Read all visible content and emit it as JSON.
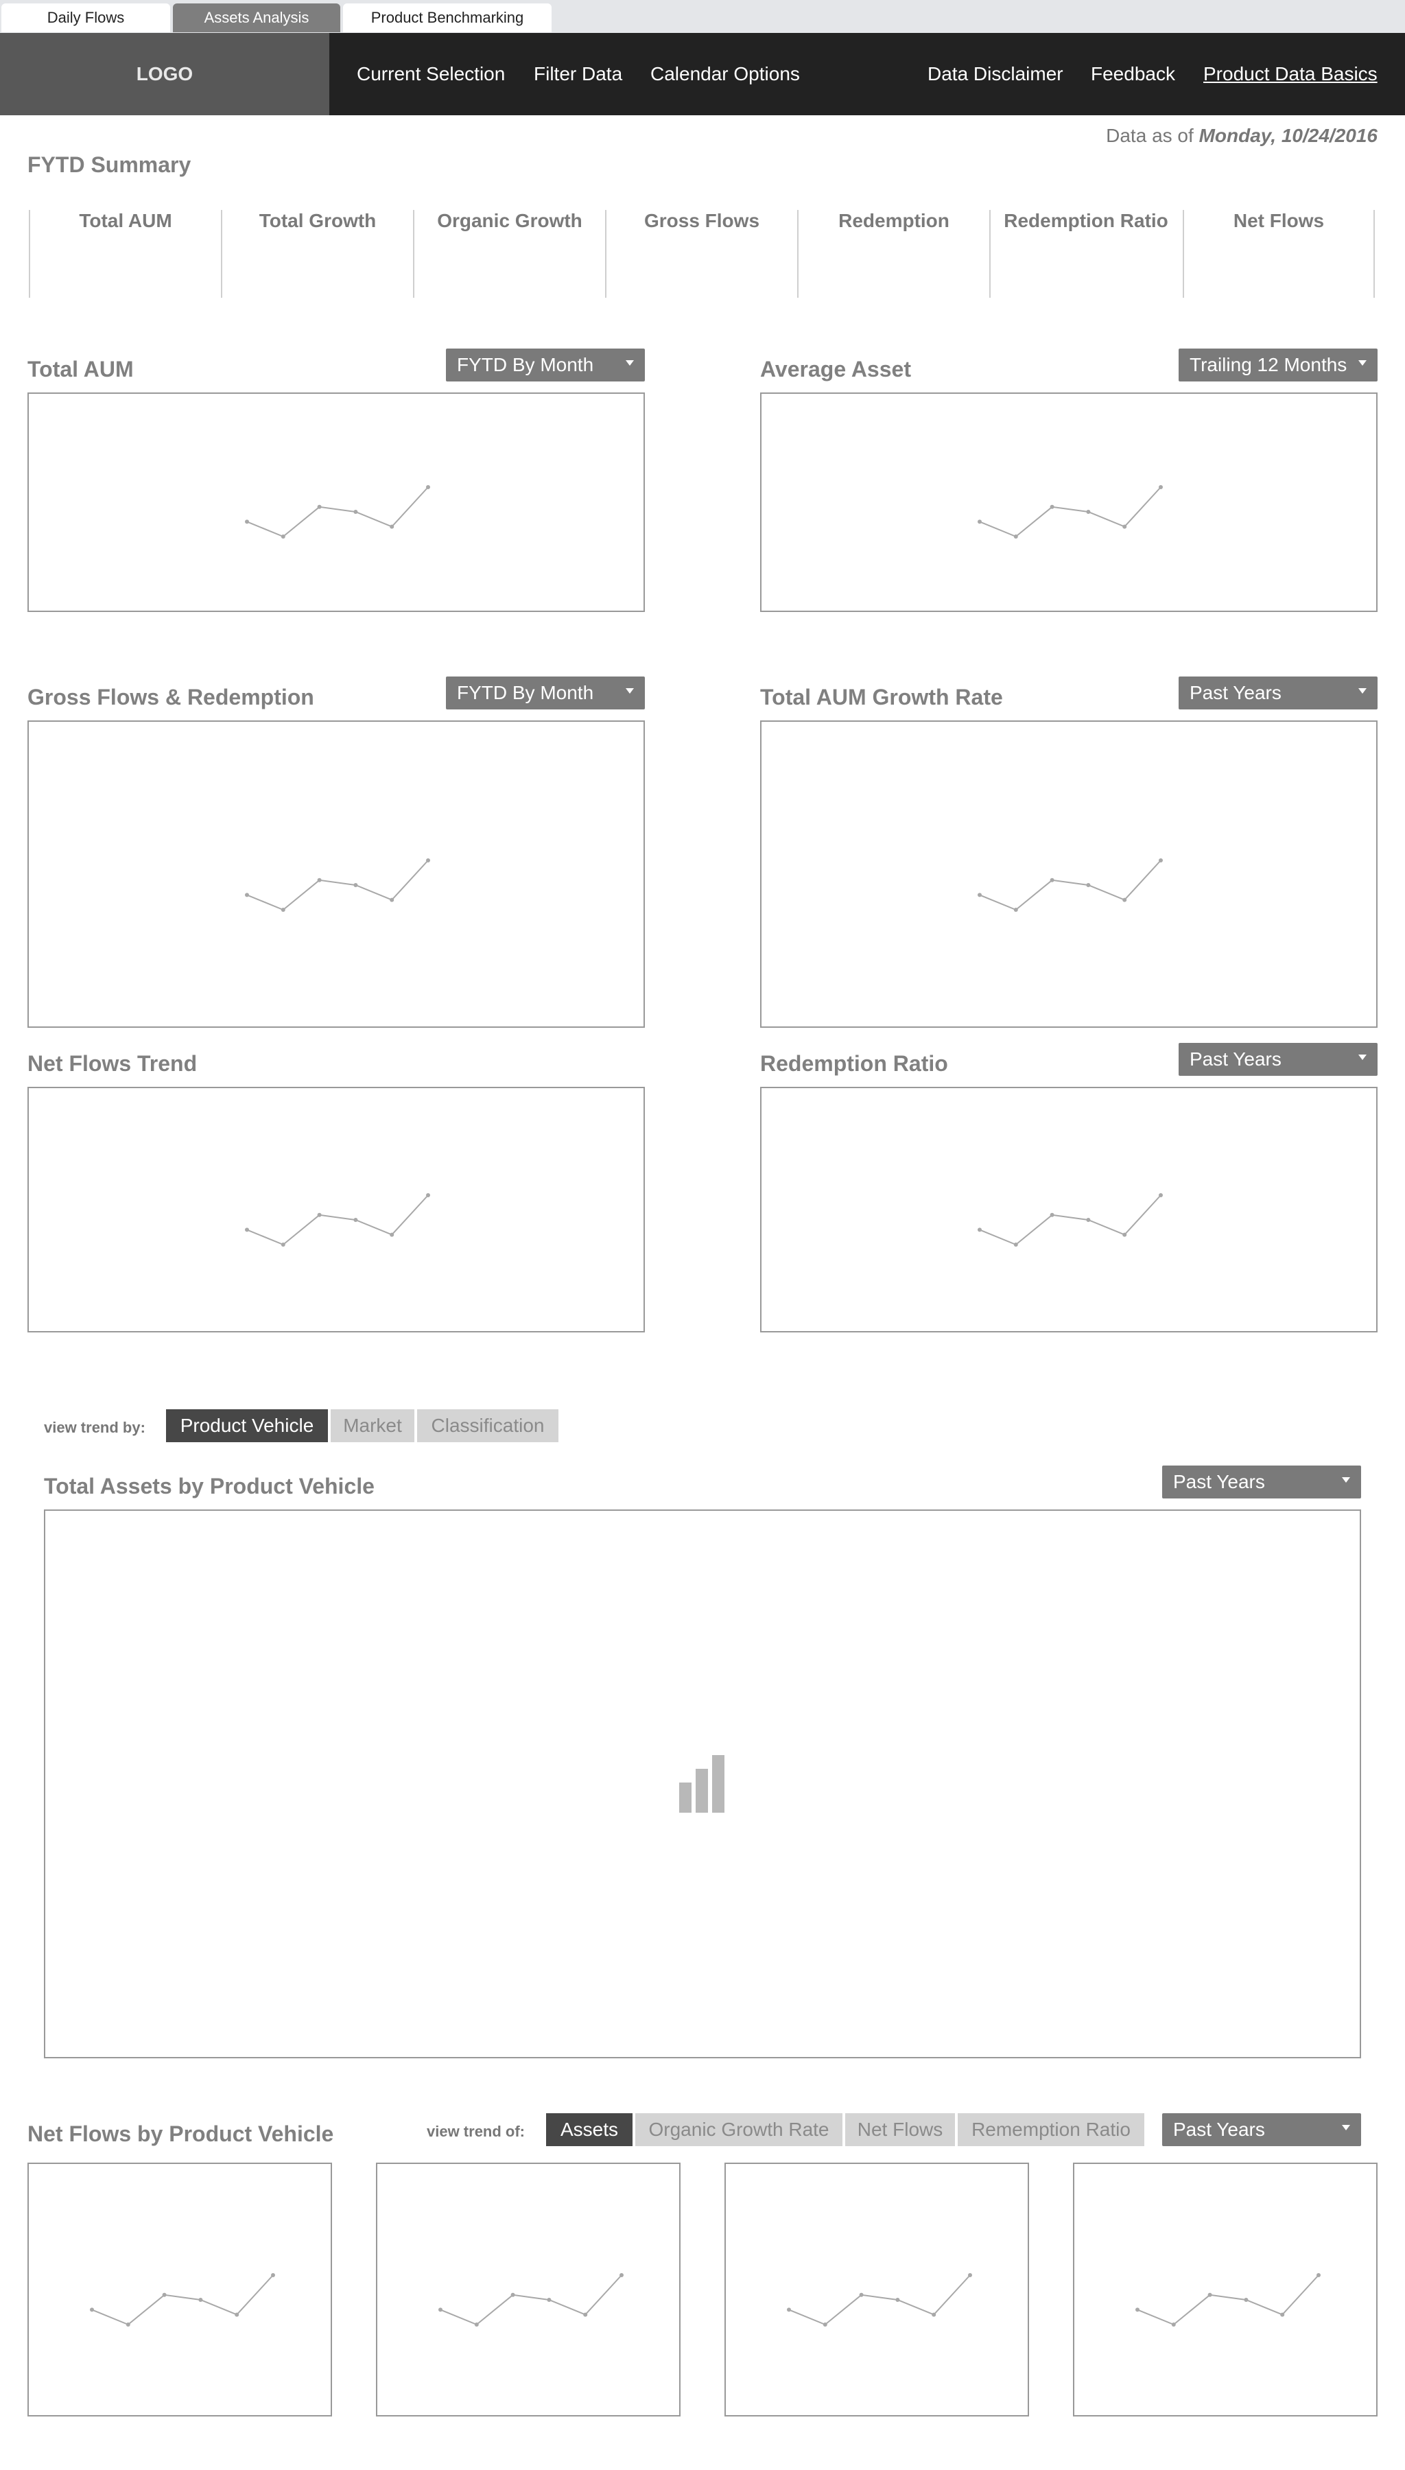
{
  "tabs": [
    "Daily Flows",
    "Assets Analysis",
    "Product Benchmarking"
  ],
  "header": {
    "logo": "LOGO",
    "nav_left": [
      "Current Selection",
      "Filter Data",
      "Calendar Options"
    ],
    "nav_right": [
      "Data Disclaimer",
      "Feedback",
      "Product Data Basics"
    ]
  },
  "data_as_of": {
    "prefix": "Data as of",
    "date": "Monday, 10/24/2016"
  },
  "fytd": {
    "title": "FYTD Summary",
    "kpis": [
      "Total AUM",
      "Total Growth",
      "Organic Growth",
      "Gross Flows",
      "Redemption",
      "Redemption Ratio",
      "Net Flows"
    ]
  },
  "charts": {
    "total_aum": {
      "title": "Total AUM",
      "dropdown": "FYTD By Month"
    },
    "average_asset": {
      "title": "Average Asset",
      "dropdown": "Trailing 12 Months"
    },
    "gross_flows": {
      "title": "Gross Flows & Redemption",
      "dropdown": "FYTD By Month"
    },
    "aum_growth": {
      "title": "Total AUM Growth Rate",
      "dropdown": "Past Years"
    },
    "net_flows_trend": {
      "title": "Net Flows Trend"
    },
    "redemption_ratio": {
      "title": "Redemption Ratio",
      "dropdown": "Past Years"
    }
  },
  "trend": {
    "label": "view trend by:",
    "options": [
      "Product Vehicle",
      "Market",
      "Classification"
    ],
    "active": "Product Vehicle"
  },
  "total_assets": {
    "title": "Total Assets by Product Vehicle",
    "dropdown": "Past Years"
  },
  "net_flows_vehicle": {
    "title": "Net Flows by Product Vehicle",
    "label": "view trend of:",
    "options": [
      "Assets",
      "Organic Growth Rate",
      "Net Flows",
      "Rememption Ratio"
    ],
    "active": "Assets",
    "dropdown": "Past Years"
  },
  "sparkline_placeholder": [
    4,
    1,
    7,
    6,
    3,
    11
  ],
  "colors": {
    "header_bg": "#222222",
    "logo_bg": "#585858",
    "dropdown_bg": "#7a7a7a",
    "toggle_active": "#474747",
    "toggle_inactive": "#d4d4d4"
  }
}
